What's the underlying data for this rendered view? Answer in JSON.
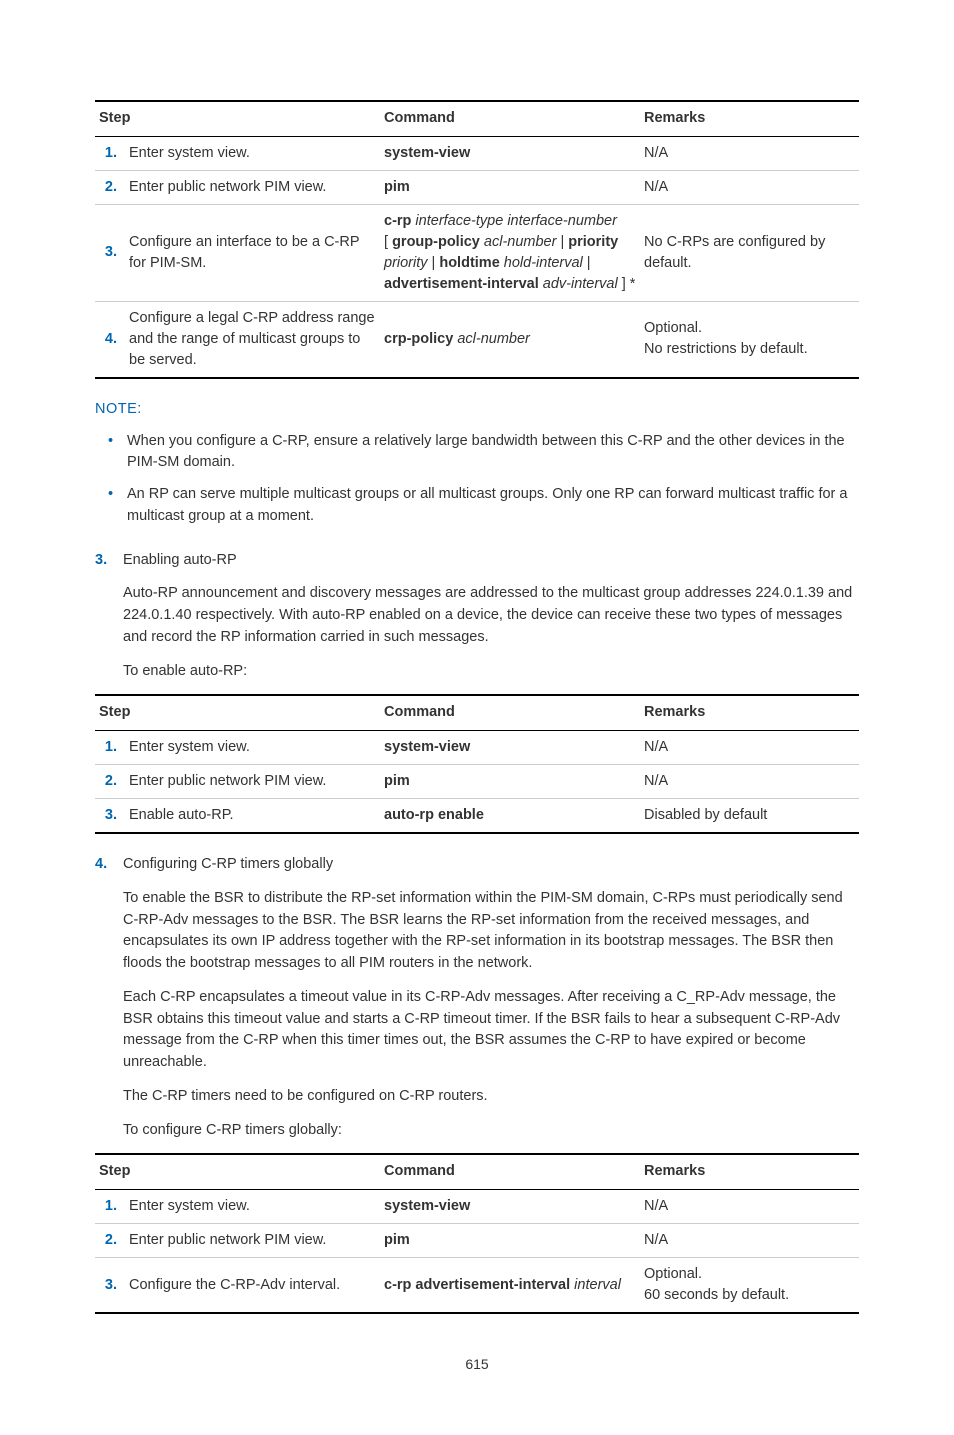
{
  "table1": {
    "headers": {
      "step": "Step",
      "command": "Command",
      "remarks": "Remarks"
    },
    "rows": [
      {
        "num": "1.",
        "step": "Enter system view.",
        "cmd_bold": "system-view",
        "remarks": "N/A"
      },
      {
        "num": "2.",
        "step": "Enter public network PIM view.",
        "cmd_bold": "pim",
        "remarks": "N/A"
      },
      {
        "num": "3.",
        "step": "Configure an interface to be a C-RP for PIM-SM.",
        "cmd_p1_b": "c-rp",
        "cmd_p1_i": " interface-type interface-number",
        "cmd_p2_t1": "[ ",
        "cmd_p2_b1": "group-policy",
        "cmd_p2_i1": " acl-number",
        "cmd_p2_t2": " | ",
        "cmd_p2_b2": "priority",
        "cmd_p3_i1": "priority",
        "cmd_p3_t1": " | ",
        "cmd_p3_b1": "holdtime",
        "cmd_p3_i2": " hold-interval",
        "cmd_p3_t2": " |",
        "cmd_p4_b": "advertisement-interval",
        "cmd_p4_i": " adv-interval",
        "cmd_p4_t": " ] *",
        "remarks": "No C-RPs are configured by default."
      },
      {
        "num": "4.",
        "step": "Configure a legal C-RP address range and the range of multicast groups to be served.",
        "cmd_bold": "crp-policy",
        "cmd_ital": " acl-number",
        "remarks1": "Optional.",
        "remarks2": "No restrictions by default."
      }
    ]
  },
  "note_label": "NOTE:",
  "note_items": [
    "When you configure a C-RP, ensure a relatively large bandwidth between this C-RP and the other devices in the PIM-SM domain.",
    "An RP can serve multiple multicast groups or all multicast groups. Only one RP can forward multicast traffic for a multicast group at a moment."
  ],
  "section3": {
    "num": "3.",
    "title": "Enabling auto-RP",
    "p1": "Auto-RP announcement and discovery messages are addressed to the multicast group addresses 224.0.1.39 and 224.0.1.40 respectively. With auto-RP enabled on a device, the device can receive these two types of messages and record the RP information carried in such messages.",
    "p2": "To enable auto-RP:"
  },
  "table2": {
    "headers": {
      "step": "Step",
      "command": "Command",
      "remarks": "Remarks"
    },
    "rows": [
      {
        "num": "1.",
        "step": "Enter system view.",
        "cmd_bold": "system-view",
        "remarks": "N/A"
      },
      {
        "num": "2.",
        "step": "Enter public network PIM view.",
        "cmd_bold": "pim",
        "remarks": "N/A"
      },
      {
        "num": "3.",
        "step": "Enable auto-RP.",
        "cmd_bold": "auto-rp enable",
        "remarks": "Disabled by default"
      }
    ]
  },
  "section4": {
    "num": "4.",
    "title": "Configuring C-RP timers globally",
    "p1": "To enable the BSR to distribute the RP-set information within the PIM-SM domain, C-RPs must periodically send C-RP-Adv messages to the BSR. The BSR learns the RP-set information from the received messages, and encapsulates its own IP address together with the RP-set information in its bootstrap messages. The BSR then floods the bootstrap messages to all PIM routers in the network.",
    "p2": "Each C-RP encapsulates a timeout value in its C-RP-Adv messages. After receiving a C_RP-Adv message, the BSR obtains this timeout value and starts a C-RP timeout timer. If the BSR fails to hear a subsequent C-RP-Adv message from the C-RP when this timer times out, the BSR assumes the C-RP to have expired or become unreachable.",
    "p3": "The C-RP timers need to be configured on C-RP routers.",
    "p4": "To configure C-RP timers globally:"
  },
  "table3": {
    "headers": {
      "step": "Step",
      "command": "Command",
      "remarks": "Remarks"
    },
    "rows": [
      {
        "num": "1.",
        "step": "Enter system view.",
        "cmd_bold": "system-view",
        "remarks": "N/A"
      },
      {
        "num": "2.",
        "step": "Enter public network PIM view.",
        "cmd_bold": "pim",
        "remarks": "N/A"
      },
      {
        "num": "3.",
        "step": "Configure the C-RP-Adv interval.",
        "cmd_bold": "c-rp advertisement-interval",
        "cmd_ital": " interval",
        "remarks1": "Optional.",
        "remarks2": "60 seconds by default."
      }
    ]
  },
  "page_num": "615"
}
